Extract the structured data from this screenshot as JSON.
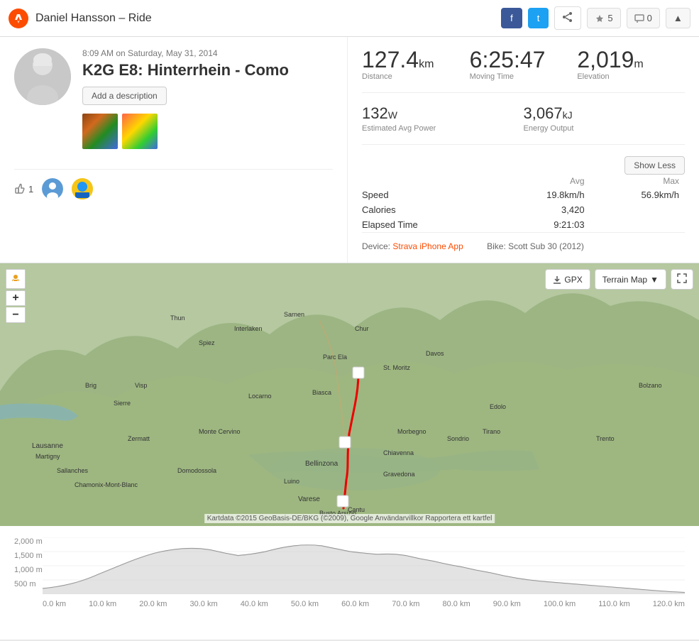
{
  "header": {
    "title": "Daniel Hansson – Ride",
    "facebook_label": "f",
    "twitter_label": "t",
    "share_label": "share",
    "kudos_count": "5",
    "comment_count": "0"
  },
  "activity": {
    "date": "8:09 AM on Saturday, May 31, 2014",
    "name": "K2G E8: Hinterrhein - Como",
    "add_description_label": "Add a description"
  },
  "stats": {
    "distance_value": "127.4",
    "distance_unit": "km",
    "distance_label": "Distance",
    "moving_time_value": "6:25:47",
    "moving_time_label": "Moving Time",
    "elevation_value": "2,019",
    "elevation_unit": "m",
    "elevation_label": "Elevation",
    "est_power_value": "132",
    "est_power_unit": "W",
    "est_power_label": "Estimated Avg Power",
    "energy_value": "3,067",
    "energy_unit": "kJ",
    "energy_label": "Energy Output",
    "show_less_label": "Show Less",
    "speed_label": "Speed",
    "speed_avg": "19.8km/h",
    "speed_max": "56.9km/h",
    "calories_label": "Calories",
    "calories_avg": "3,420",
    "elapsed_label": "Elapsed Time",
    "elapsed_avg": "9:21:03",
    "avg_header": "Avg",
    "max_header": "Max",
    "device_label": "Device:",
    "device_name": "Strava iPhone App",
    "bike_label": "Bike: Scott Sub 30 (2012)"
  },
  "map": {
    "gpx_label": "GPX",
    "terrain_label": "Terrain Map",
    "copyright": "Kartdata ©2015 GeoBasis-DE/BKG (©2009), Google    Användarvillkor    Rapportera ett kartfel"
  },
  "elevation_chart": {
    "y_labels": [
      "2,000 m",
      "1,500 m",
      "1,000 m",
      "500 m",
      ""
    ],
    "x_labels": [
      "0.0 km",
      "10.0 km",
      "20.0 km",
      "30.0 km",
      "40.0 km",
      "50.0 km",
      "60.0 km",
      "70.0 km",
      "80.0 km",
      "90.0 km",
      "100.0 km",
      "110.0 km",
      "120.0 km"
    ]
  },
  "social": {
    "kudos_count": "1",
    "follower_count": "1"
  }
}
